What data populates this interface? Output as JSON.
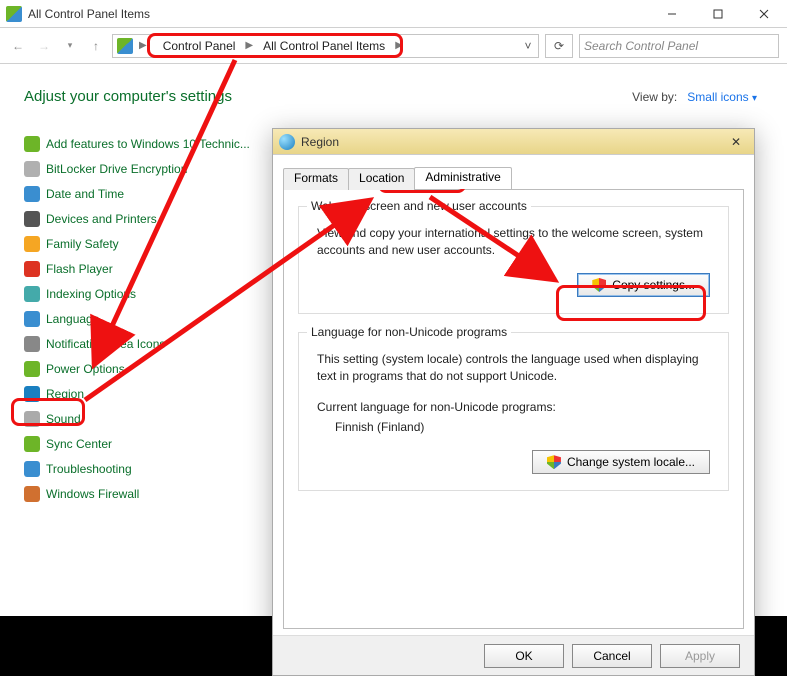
{
  "window": {
    "title": "All Control Panel Items",
    "search_placeholder": "Search Control Panel"
  },
  "breadcrumbs": [
    "Control Panel",
    "All Control Panel Items"
  ],
  "heading": "Adjust your computer's settings",
  "view_by": {
    "label": "View by:",
    "value": "Small icons"
  },
  "items": [
    {
      "label": "Add features to Windows 10 Technic...",
      "color": "#6db528"
    },
    {
      "label": "BitLocker Drive Encryption",
      "color": "#b0b0b0"
    },
    {
      "label": "Date and Time",
      "color": "#3a8ed0"
    },
    {
      "label": "Devices and Printers",
      "color": "#555"
    },
    {
      "label": "Family Safety",
      "color": "#f5a623"
    },
    {
      "label": "Flash Player",
      "color": "#d32"
    },
    {
      "label": "Indexing Options",
      "color": "#4aa"
    },
    {
      "label": "Language",
      "color": "#3a8ed0"
    },
    {
      "label": "Notification Area Icons",
      "color": "#888"
    },
    {
      "label": "Power Options",
      "color": "#6db528"
    },
    {
      "label": "Region",
      "color": "#1a7fc0"
    },
    {
      "label": "Sound",
      "color": "#aaa"
    },
    {
      "label": "Sync Center",
      "color": "#6db528"
    },
    {
      "label": "Troubleshooting",
      "color": "#3a8ed0"
    },
    {
      "label": "Windows Firewall",
      "color": "#d07030"
    }
  ],
  "dialog": {
    "title": "Region",
    "tabs": [
      "Formats",
      "Location",
      "Administrative"
    ],
    "active_tab": 2,
    "group1": {
      "title": "Welcome screen and new user accounts",
      "text": "View and copy your international settings to the welcome screen, system accounts and new user accounts.",
      "button": "Copy settings..."
    },
    "group2": {
      "title": "Language for non-Unicode programs",
      "text": "This setting (system locale) controls the language used when displaying text in programs that do not support Unicode.",
      "current_label": "Current language for non-Unicode programs:",
      "current_value": "Finnish (Finland)",
      "button": "Change system locale..."
    },
    "buttons": {
      "ok": "OK",
      "cancel": "Cancel",
      "apply": "Apply"
    }
  }
}
